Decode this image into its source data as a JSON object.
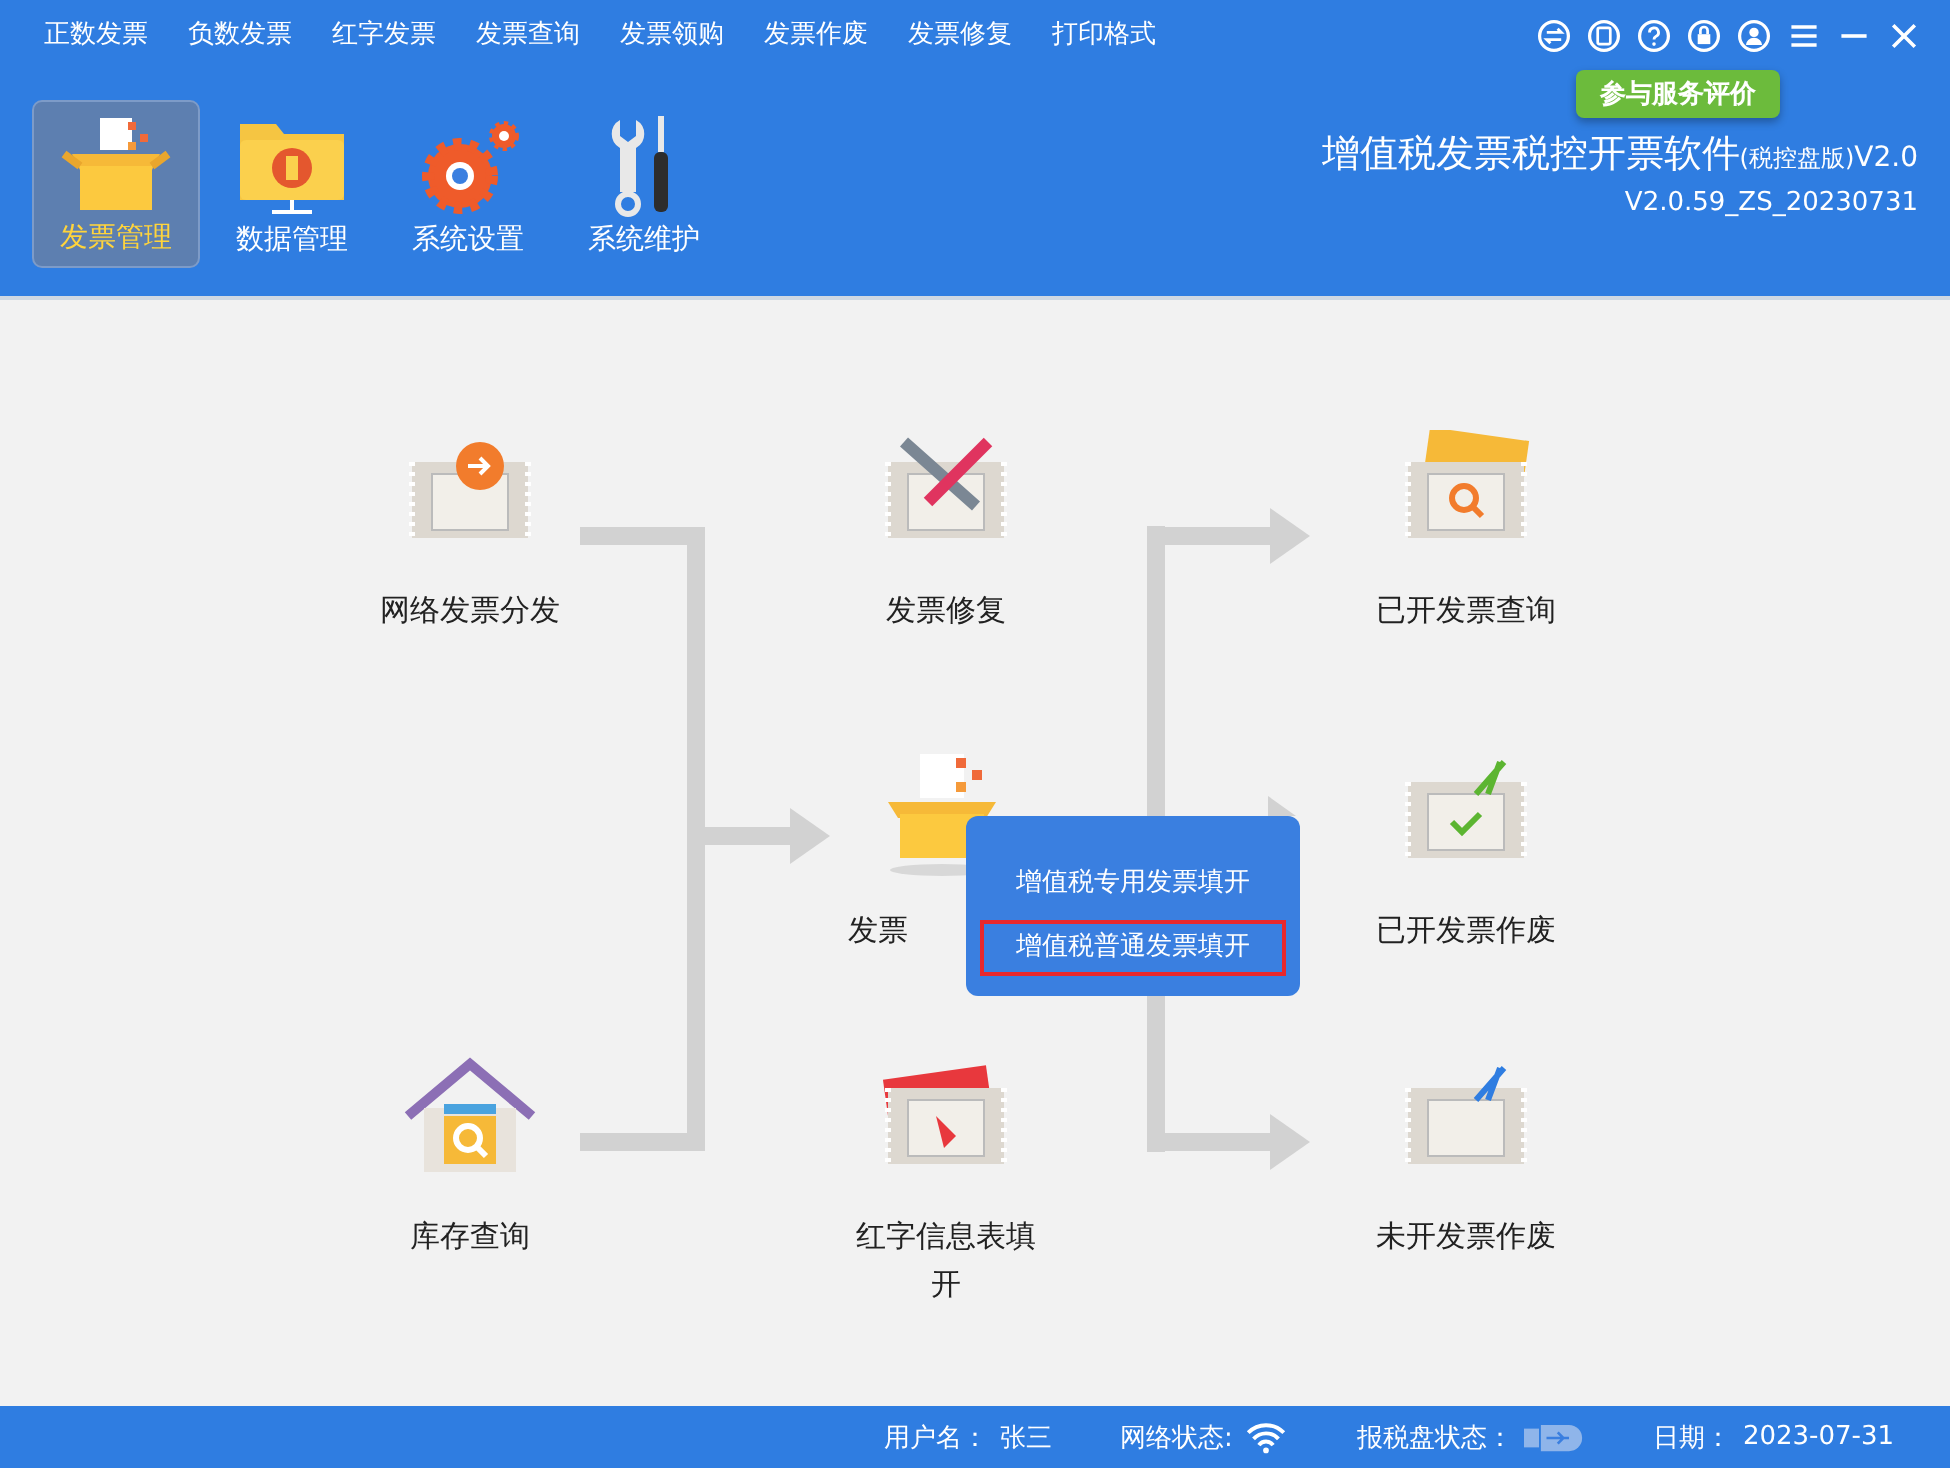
{
  "menu": [
    "正数发票",
    "负数发票",
    "红字发票",
    "发票查询",
    "发票领购",
    "发票作废",
    "发票修复",
    "打印格式"
  ],
  "tooltip": "参与服务评价",
  "toolbar": [
    {
      "label": "发票管理",
      "kind": "box",
      "selected": true
    },
    {
      "label": "数据管理",
      "kind": "folder",
      "selected": false
    },
    {
      "label": "系统设置",
      "kind": "gear",
      "selected": false
    },
    {
      "label": "系统维护",
      "kind": "tools",
      "selected": false
    }
  ],
  "app_title": {
    "name": "增值税发票税控开票软件",
    "edition": "(税控盘版)",
    "version": "V2.0",
    "build": "V2.0.59_ZS_20230731"
  },
  "flow": [
    {
      "label": "网络发票分发",
      "kind": "distribute"
    },
    {
      "label": "库存查询",
      "kind": "stock"
    },
    {
      "label": "发票修复",
      "kind": "repair"
    },
    {
      "label": "发票",
      "kind": "issue"
    },
    {
      "label": "红字信息表填开",
      "kind": "red"
    },
    {
      "label": "已开发票查询",
      "kind": "query"
    },
    {
      "label": "已开发票作废",
      "kind": "void_done"
    },
    {
      "label": "未开发票作废",
      "kind": "void_blank"
    }
  ],
  "popup": [
    {
      "label": "增值税专用发票填开",
      "selected": false
    },
    {
      "label": "增值税普通发票填开",
      "selected": true
    }
  ],
  "status": {
    "user_label": "用户名：",
    "user": "张三",
    "network_label": "网络状态:",
    "disk_label": "报税盘状态：",
    "date_label": "日期：",
    "date": "2023-07-31"
  }
}
